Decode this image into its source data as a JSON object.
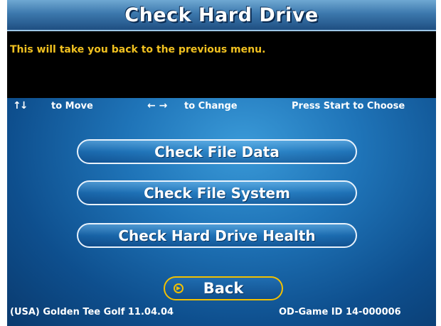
{
  "screen": {
    "title": "Check Hard Drive",
    "message": "This will take you back to the previous menu."
  },
  "controls": {
    "move_icon": "up-down-arrows-icon",
    "move_arrows": "↑↓",
    "move_hint": "to Move",
    "change_icon": "left-right-arrows-icon",
    "change_arrows": "← →",
    "change_hint": "to Change",
    "start_hint": "Press Start to Choose"
  },
  "menu": {
    "items": [
      {
        "label": "Check File Data"
      },
      {
        "label": "Check File System"
      },
      {
        "label": "Check Hard Drive Health"
      }
    ],
    "back": {
      "label": "Back",
      "icon": "chevron-right-circle-icon",
      "selected": true
    }
  },
  "footer": {
    "version": "(USA) Golden Tee Golf 11.04.04",
    "game_id": "OD-Game ID 14-000006"
  },
  "colors": {
    "message_text": "#f0c020",
    "selected_outline": "#f2c000",
    "button_outline": "#e8f2fc",
    "background": "#1f74b8"
  }
}
